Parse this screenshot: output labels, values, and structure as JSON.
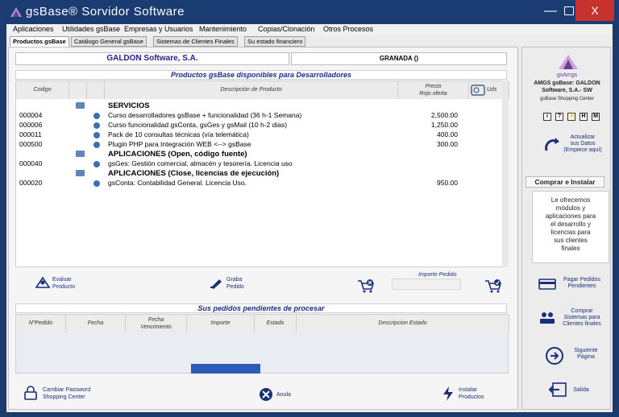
{
  "window": {
    "title": "gsBase®   Sorvidor Software",
    "close_label": "X"
  },
  "menu": [
    "Aplicaciones",
    "Utilidades gsBase",
    "Empresas y Usuarios",
    "Mantenimiento",
    "Copias/Clonación",
    "Otros Procesos"
  ],
  "tabs": [
    "Productos gsBase",
    "Catálogo General gsBase",
    "Sistemas de Clientes Finales",
    "Su estado financiero"
  ],
  "header": {
    "company": "GALDON Software, S.A.",
    "city": "GRANADA ()"
  },
  "products": {
    "title": "Productos gsBase disponibles para Desarrolladores",
    "columns": {
      "codigo": "Codigo",
      "descripcion": "Descripción de Producto",
      "precio": "Precio",
      "precio_sub": "Rojo oferta",
      "uds": "Uds"
    },
    "rows": [
      {
        "type": "category",
        "codigo": "",
        "desc": "SERVICIOS",
        "price": ""
      },
      {
        "type": "item",
        "codigo": "000004",
        "desc": "Curso desarrolladores gsBase + funcionalidad (36 h-1 Semana)",
        "price": "2,500.00"
      },
      {
        "type": "item",
        "codigo": "000006",
        "desc": "Curso funcionalidad gsConta, gsGes y gsMail (10 h-2 dias)",
        "price": "1,250.00"
      },
      {
        "type": "item",
        "codigo": "000011",
        "desc": "Pack de 10 consultas técnicas (vía telemática)",
        "price": "400.00"
      },
      {
        "type": "item",
        "codigo": "000500",
        "desc": "Plugin PHP para Integración WEB <--> gsBase",
        "price": "300.00"
      },
      {
        "type": "category",
        "codigo": "",
        "desc": "APLICACIONES (Open, código fuente)",
        "price": ""
      },
      {
        "type": "item",
        "codigo": "000040",
        "desc": "gsGes: Gestión comercial, almacén y tesorería. Licencia uso",
        "price": ""
      },
      {
        "type": "category",
        "codigo": "",
        "desc": "APLICACIONES (Close, licencias de ejecución)",
        "price": ""
      },
      {
        "type": "item",
        "codigo": "000020",
        "desc": "gsConta: Contabilidad General. Licencia Uso.",
        "price": "950.00"
      }
    ]
  },
  "actions": {
    "evaluar": "Evaluar\nProducto",
    "evaluar_1": "Evaluar",
    "evaluar_2": "Producto",
    "graba_1": "Graba",
    "graba_2": "Pedido",
    "importe_label": "Importe Pedido",
    "importe_value": ""
  },
  "pedidos": {
    "title": "Sus pedidos pendientes de procesar",
    "columns": {
      "num": "NºPedido",
      "fecha": "Fecha",
      "venc_1": "Fecha",
      "venc_2": "Vencimiento",
      "importe": "Importe",
      "estado": "Estado",
      "desc": "Descripcion Estado"
    }
  },
  "bottom": {
    "cambiar_1": "Cambiar Password",
    "cambiar_2": "Shopping Center",
    "anula": "Anula",
    "instalar_1": "Instalar",
    "instalar_2": "Productos"
  },
  "sidebar": {
    "brand": "gsAmgs",
    "company_1": "AMGS gsBase: GALDON",
    "company_2": "Software, S.A.- SW",
    "shop": "gsBase Shopping Center",
    "icons": [
      "i",
      "?",
      "⚡",
      "H",
      "M"
    ],
    "actualizar_1": "Actualizar",
    "actualizar_2": "sus Datos",
    "actualizar_3": "(Empiece aquí)",
    "comprar": "Comprar e Instalar",
    "ofrece": [
      "Le ofrecemos",
      "módulos y",
      "aplicaciones para",
      "el desarrollo y",
      "licencias para",
      "sus clientes",
      "finales"
    ],
    "pagar_1": "Pagar Pedidos",
    "pagar_2": "Pendientes",
    "sistemas_1": "Comprar",
    "sistemas_2": "Sistemas para",
    "sistemas_3": "Clientes finales",
    "siguiente_1": "Siguiente",
    "siguiente_2": "Página",
    "salida": "Salida"
  },
  "colors": {
    "titlebar": "#1b3c72",
    "close": "#c8322d",
    "accent": "#2f5bb8",
    "link": "#1a2f7a"
  }
}
